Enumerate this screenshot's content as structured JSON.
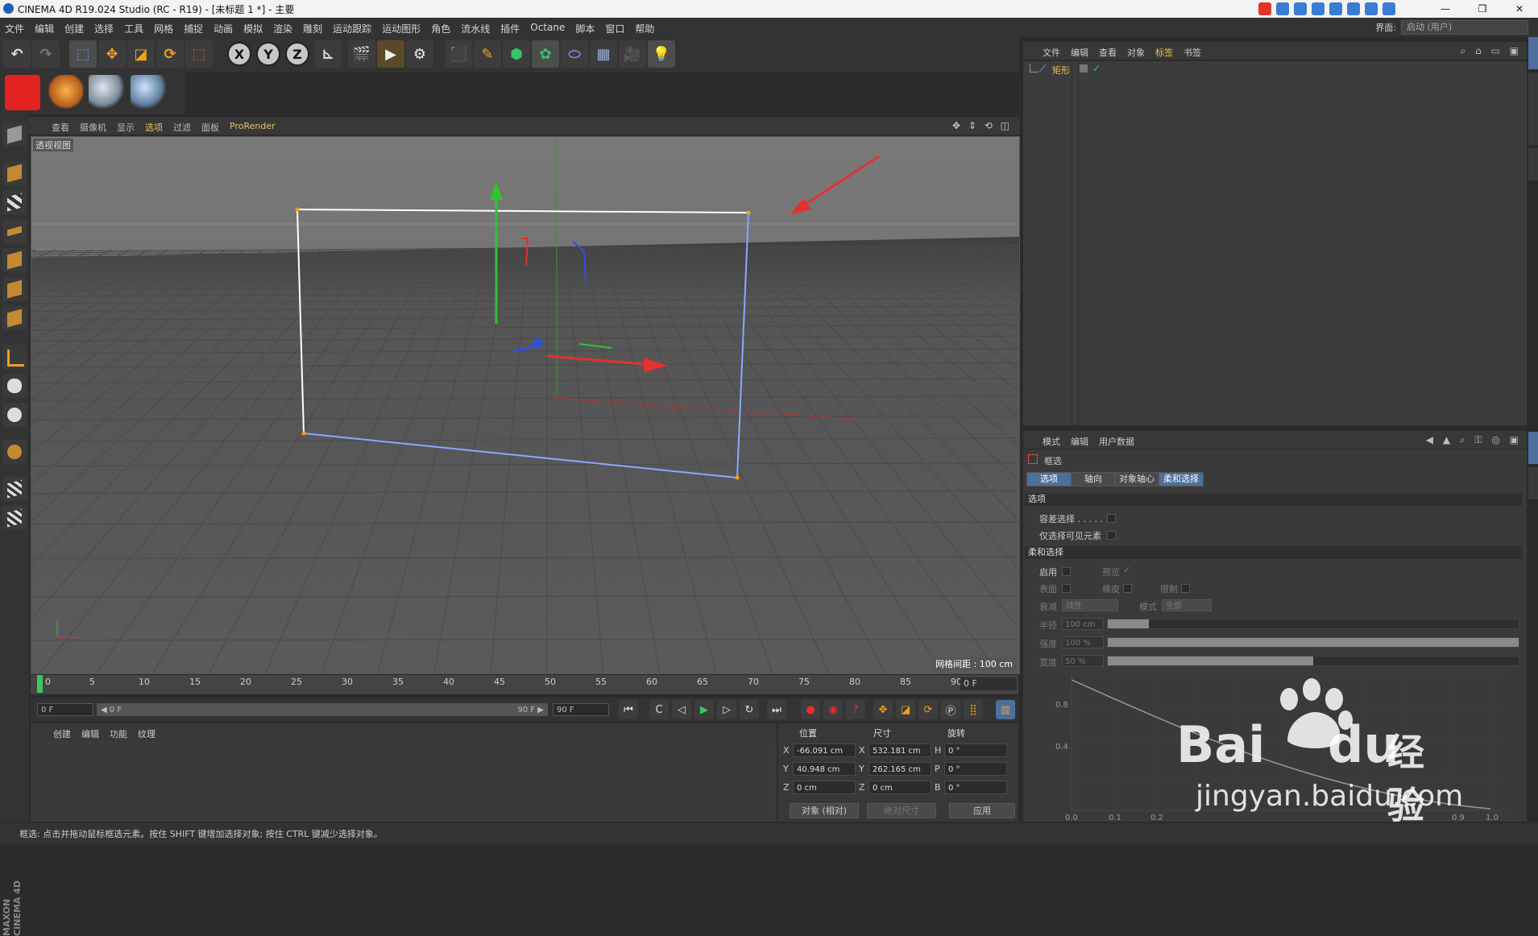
{
  "window": {
    "title": "CINEMA 4D R19.024 Studio (RC - R19) - [未标题 1 *] - 主要",
    "controls": [
      "—",
      "❐",
      "✕"
    ]
  },
  "menubar": {
    "items": [
      "文件",
      "编辑",
      "创建",
      "选择",
      "工具",
      "网格",
      "捕捉",
      "动画",
      "模拟",
      "渲染",
      "雕刻",
      "运动跟踪",
      "运动图形",
      "角色",
      "流水线",
      "插件",
      "Octane",
      "脚本",
      "窗口",
      "帮助"
    ],
    "layout_label": "界面:",
    "layout_value": "启动 (用户)"
  },
  "toolbar": {
    "axis_x": "X",
    "axis_y": "Y",
    "axis_z": "Z"
  },
  "viewport": {
    "menu": [
      "查看",
      "摄像机",
      "显示",
      "选项",
      "过滤",
      "面板",
      "ProRender"
    ],
    "active_menu": "选项",
    "view_name": "透视视图",
    "grid_spacing": "网格间距 : 100 cm",
    "nav_icons": "✥ ⇕ ⟲ ◫"
  },
  "timeline": {
    "ticks": [
      "0",
      "5",
      "10",
      "15",
      "20",
      "25",
      "30",
      "35",
      "40",
      "45",
      "50",
      "55",
      "60",
      "65",
      "70",
      "75",
      "80",
      "85",
      "90"
    ],
    "current_frame": "0 F",
    "start_frame": "0 F",
    "range_start": "◀ 0 F",
    "range_end": "90 F ▶",
    "end_frame": "90 F"
  },
  "materials": {
    "menu": [
      "创建",
      "编辑",
      "功能",
      "纹理"
    ]
  },
  "coordinates": {
    "headers": [
      "位置",
      "尺寸",
      "旋转"
    ],
    "rows": [
      {
        "axis": "X",
        "pos": "-66.091 cm",
        "saxis": "X",
        "size": "532.181 cm",
        "raxis": "H",
        "rot": "0 °"
      },
      {
        "axis": "Y",
        "pos": "40.948 cm",
        "saxis": "Y",
        "size": "262.165 cm",
        "raxis": "P",
        "rot": "0 °"
      },
      {
        "axis": "Z",
        "pos": "0 cm",
        "saxis": "Z",
        "size": "0 cm",
        "raxis": "B",
        "rot": "0 °"
      }
    ],
    "mode": "对象 (相对)",
    "size_mode": "绝对尺寸",
    "apply": "应用"
  },
  "objects": {
    "menu": [
      "文件",
      "编辑",
      "查看",
      "对象",
      "标签",
      "书签"
    ],
    "active_menu": "标签",
    "items": [
      {
        "name": "矩形"
      }
    ],
    "header_icons": "⌕ ⌂ ▭ ▣"
  },
  "attributes": {
    "menu": [
      "模式",
      "编辑",
      "用户数据"
    ],
    "tool_name": "框选",
    "tabs": [
      "选项",
      "轴向",
      "对象轴心",
      "柔和选择"
    ],
    "section_options": "选项",
    "opt_tolerant": "容差选择 . . . . . .",
    "opt_visible_only": "仅选择可见元素",
    "section_soft": "柔和选择",
    "enable": "启用",
    "preview": "预览",
    "preview_check": "✓",
    "surface": "表面",
    "rubber": "橡皮",
    "restrict": "限制",
    "falloff_label": "衰减",
    "falloff_value": "线性",
    "mode_label": "模式",
    "mode_value": "全部",
    "radius_label": "半径",
    "radius_value": "100 cm",
    "strength_label": "强度",
    "strength_value": "100 %",
    "width_label": "宽度",
    "width_value": "50 %",
    "radius_level": 0.1,
    "strength_level": 1.0,
    "width_level": 0.5,
    "curve_y_labels": [
      "0.8",
      "0.4"
    ],
    "curve_x_labels": [
      "0.0",
      "0.1",
      "0.2",
      "0.9",
      "1.0"
    ]
  },
  "status": {
    "text": "框选: 点击并拖动鼠标框选元素。按住 SHIFT 键增加选择对象; 按住 CTRL 键减少选择对象。"
  },
  "watermark": {
    "brand": "Bai",
    "brand2": "du",
    "cn": "经验",
    "url": "jingyan.baidu.com"
  },
  "colors": {
    "accent": "#f0c050",
    "tab_active": "#4c6f9c",
    "viewport_bg": "#6d6d6d",
    "axis_x": "#e53030",
    "axis_y": "#2ec42e",
    "axis_z": "#2f4fe0"
  }
}
